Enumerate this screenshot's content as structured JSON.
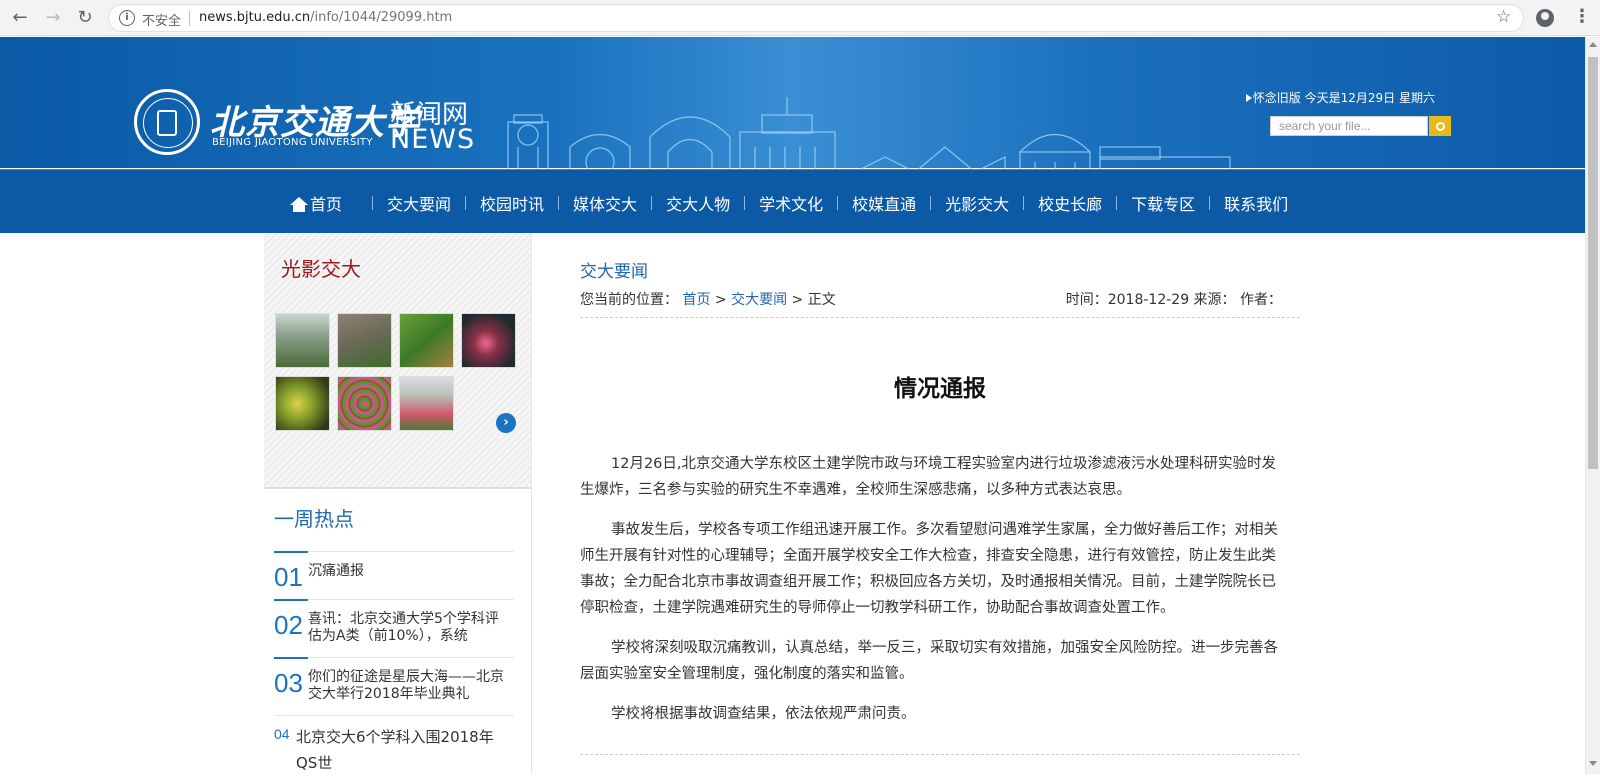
{
  "browser": {
    "back_icon": "arrow-left-icon",
    "forward_icon": "arrow-right-icon",
    "reload_icon": "reload-icon",
    "security_label": "不安全",
    "url_host": "news.bjtu.edu.cn",
    "url_path": "/info/1044/29099.htm"
  },
  "header": {
    "logo_cn": "北京交通大学",
    "logo_en": "BEIJING JIAOTONG UNIVERSITY",
    "site_cn": "新闻网",
    "site_en": "NEWS",
    "old_version": "怀念旧版",
    "today": "今天是12月29日  星期六",
    "search_placeholder": "search your file..."
  },
  "nav": {
    "items": [
      "首页",
      "交大要闻",
      "校园时讯",
      "媒体交大",
      "交大人物",
      "学术文化",
      "校媒直通",
      "光影交大",
      "校史长廊",
      "下载专区",
      "联系我们"
    ]
  },
  "gallery": {
    "title": "光影交大"
  },
  "hot": {
    "title": "一周热点",
    "items": [
      {
        "num": "01",
        "text": "沉痛通报"
      },
      {
        "num": "02",
        "text": "喜讯：北京交通大学5个学科评估为A类（前10%），系统"
      },
      {
        "num": "03",
        "text": "你们的征途是星辰大海——北京交大举行2018年毕业典礼"
      },
      {
        "num": "04",
        "text": "北京交大6个学科入围2018年QS世"
      }
    ]
  },
  "article": {
    "section": "交大要闻",
    "crumb_prefix": "您当前的位置：",
    "crumb_home": "首页",
    "crumb_section": "交大要闻",
    "crumb_current": "正文",
    "meta": "时间：2018-12-29 来源： 作者：",
    "title": "情况通报",
    "paragraphs": [
      "12月26日,北京交通大学东校区土建学院市政与环境工程实验室内进行垃圾渗滤液污水处理科研实验时发生爆炸，三名参与实验的研究生不幸遇难，全校师生深感悲痛，以多种方式表达哀思。",
      "事故发生后，学校各专项工作组迅速开展工作。多次看望慰问遇难学生家属，全力做好善后工作；对相关师生开展有针对性的心理辅导；全面开展学校安全工作大检查，排查安全隐患，进行有效管控，防止发生此类事故；全力配合北京市事故调查组开展工作；积极回应各方关切，及时通报相关情况。目前，土建学院院长已停职检查，土建学院遇难研究生的导师停止一切教学科研工作，协助配合事故调查处置工作。",
      "学校将深刻吸取沉痛教训，认真总结，举一反三，采取切实有效措施，加强安全风险防控。进一步完善各层面实验室安全管理制度，强化制度的落实和监管。",
      "学校将根据事故调查结果，依法依规严肃问责。"
    ]
  }
}
